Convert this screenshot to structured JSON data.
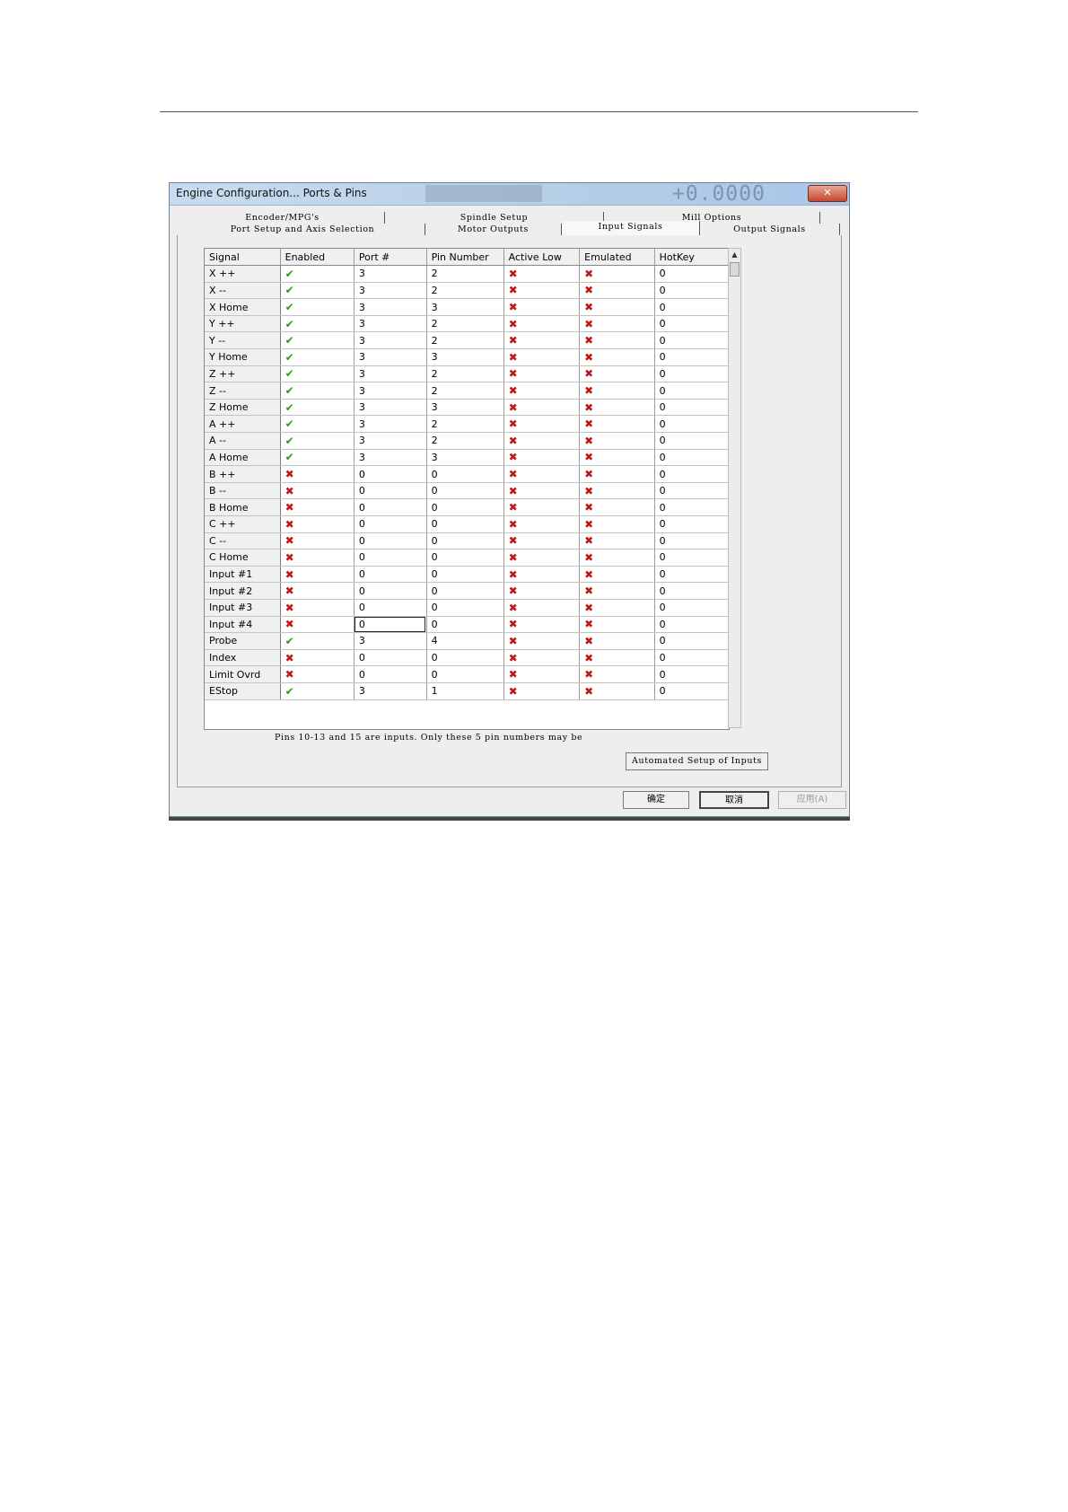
{
  "window": {
    "title": "Engine Configuration... Ports & Pins",
    "close_label": "✕",
    "background_readout": "+0.0000"
  },
  "tabs": {
    "row1": [
      "Encoder/MPG's",
      "Spindle Setup",
      "Mill Options"
    ],
    "row2": [
      "Port Setup and Axis Selection",
      "Motor Outputs",
      "Input Signals",
      "Output Signals"
    ],
    "active": "Input Signals"
  },
  "grid": {
    "columns": [
      "Signal",
      "Enabled",
      "Port #",
      "Pin Number",
      "Active Low",
      "Emulated",
      "HotKey"
    ],
    "rows": [
      {
        "signal": "X ++",
        "enabled": "✔",
        "port": "3",
        "pin": "2",
        "active_low": "✖",
        "emulated": "✖",
        "hotkey": "0"
      },
      {
        "signal": "X --",
        "enabled": "✔",
        "port": "3",
        "pin": "2",
        "active_low": "✖",
        "emulated": "✖",
        "hotkey": "0"
      },
      {
        "signal": "X Home",
        "enabled": "✔",
        "port": "3",
        "pin": "3",
        "active_low": "✖",
        "emulated": "✖",
        "hotkey": "0"
      },
      {
        "signal": "Y ++",
        "enabled": "✔",
        "port": "3",
        "pin": "2",
        "active_low": "✖",
        "emulated": "✖",
        "hotkey": "0"
      },
      {
        "signal": "Y --",
        "enabled": "✔",
        "port": "3",
        "pin": "2",
        "active_low": "✖",
        "emulated": "✖",
        "hotkey": "0"
      },
      {
        "signal": "Y Home",
        "enabled": "✔",
        "port": "3",
        "pin": "3",
        "active_low": "✖",
        "emulated": "✖",
        "hotkey": "0"
      },
      {
        "signal": "Z ++",
        "enabled": "✔",
        "port": "3",
        "pin": "2",
        "active_low": "✖",
        "emulated": "✖",
        "hotkey": "0"
      },
      {
        "signal": "Z --",
        "enabled": "✔",
        "port": "3",
        "pin": "2",
        "active_low": "✖",
        "emulated": "✖",
        "hotkey": "0"
      },
      {
        "signal": "Z Home",
        "enabled": "✔",
        "port": "3",
        "pin": "3",
        "active_low": "✖",
        "emulated": "✖",
        "hotkey": "0"
      },
      {
        "signal": "A ++",
        "enabled": "✔",
        "port": "3",
        "pin": "2",
        "active_low": "✖",
        "emulated": "✖",
        "hotkey": "0"
      },
      {
        "signal": "A --",
        "enabled": "✔",
        "port": "3",
        "pin": "2",
        "active_low": "✖",
        "emulated": "✖",
        "hotkey": "0"
      },
      {
        "signal": "A Home",
        "enabled": "✔",
        "port": "3",
        "pin": "3",
        "active_low": "✖",
        "emulated": "✖",
        "hotkey": "0"
      },
      {
        "signal": "B ++",
        "enabled": "✖",
        "port": "0",
        "pin": "0",
        "active_low": "✖",
        "emulated": "✖",
        "hotkey": "0"
      },
      {
        "signal": "B --",
        "enabled": "✖",
        "port": "0",
        "pin": "0",
        "active_low": "✖",
        "emulated": "✖",
        "hotkey": "0"
      },
      {
        "signal": "B Home",
        "enabled": "✖",
        "port": "0",
        "pin": "0",
        "active_low": "✖",
        "emulated": "✖",
        "hotkey": "0"
      },
      {
        "signal": "C ++",
        "enabled": "✖",
        "port": "0",
        "pin": "0",
        "active_low": "✖",
        "emulated": "✖",
        "hotkey": "0"
      },
      {
        "signal": "C --",
        "enabled": "✖",
        "port": "0",
        "pin": "0",
        "active_low": "✖",
        "emulated": "✖",
        "hotkey": "0"
      },
      {
        "signal": "C Home",
        "enabled": "✖",
        "port": "0",
        "pin": "0",
        "active_low": "✖",
        "emulated": "✖",
        "hotkey": "0"
      },
      {
        "signal": "Input #1",
        "enabled": "✖",
        "port": "0",
        "pin": "0",
        "active_low": "✖",
        "emulated": "✖",
        "hotkey": "0"
      },
      {
        "signal": "Input #2",
        "enabled": "✖",
        "port": "0",
        "pin": "0",
        "active_low": "✖",
        "emulated": "✖",
        "hotkey": "0"
      },
      {
        "signal": "Input #3",
        "enabled": "✖",
        "port": "0",
        "pin": "0",
        "active_low": "✖",
        "emulated": "✖",
        "hotkey": "0"
      },
      {
        "signal": "Input #4",
        "enabled": "✖",
        "port": "0",
        "pin": "0",
        "active_low": "✖",
        "emulated": "✖",
        "hotkey": "0"
      },
      {
        "signal": "Probe",
        "enabled": "✔",
        "port": "3",
        "pin": "4",
        "active_low": "✖",
        "emulated": "✖",
        "hotkey": "0"
      },
      {
        "signal": "Index",
        "enabled": "✖",
        "port": "0",
        "pin": "0",
        "active_low": "✖",
        "emulated": "✖",
        "hotkey": "0"
      },
      {
        "signal": "Limit Ovrd",
        "enabled": "✖",
        "port": "0",
        "pin": "0",
        "active_low": "✖",
        "emulated": "✖",
        "hotkey": "0"
      },
      {
        "signal": "EStop",
        "enabled": "✔",
        "port": "3",
        "pin": "1",
        "active_low": "✖",
        "emulated": "✖",
        "hotkey": "0"
      }
    ]
  },
  "note": "Pins 10-13 and 15 are inputs. Only these 5 pin numbers may be",
  "buttons": {
    "automated_setup": "Automated Setup of Inputs",
    "ok": "确定",
    "cancel": "取消",
    "apply": "应用(A)"
  },
  "colors": {
    "check": "#2f9b1a",
    "cross": "#c01818",
    "titlebar": "#b5cde6"
  }
}
